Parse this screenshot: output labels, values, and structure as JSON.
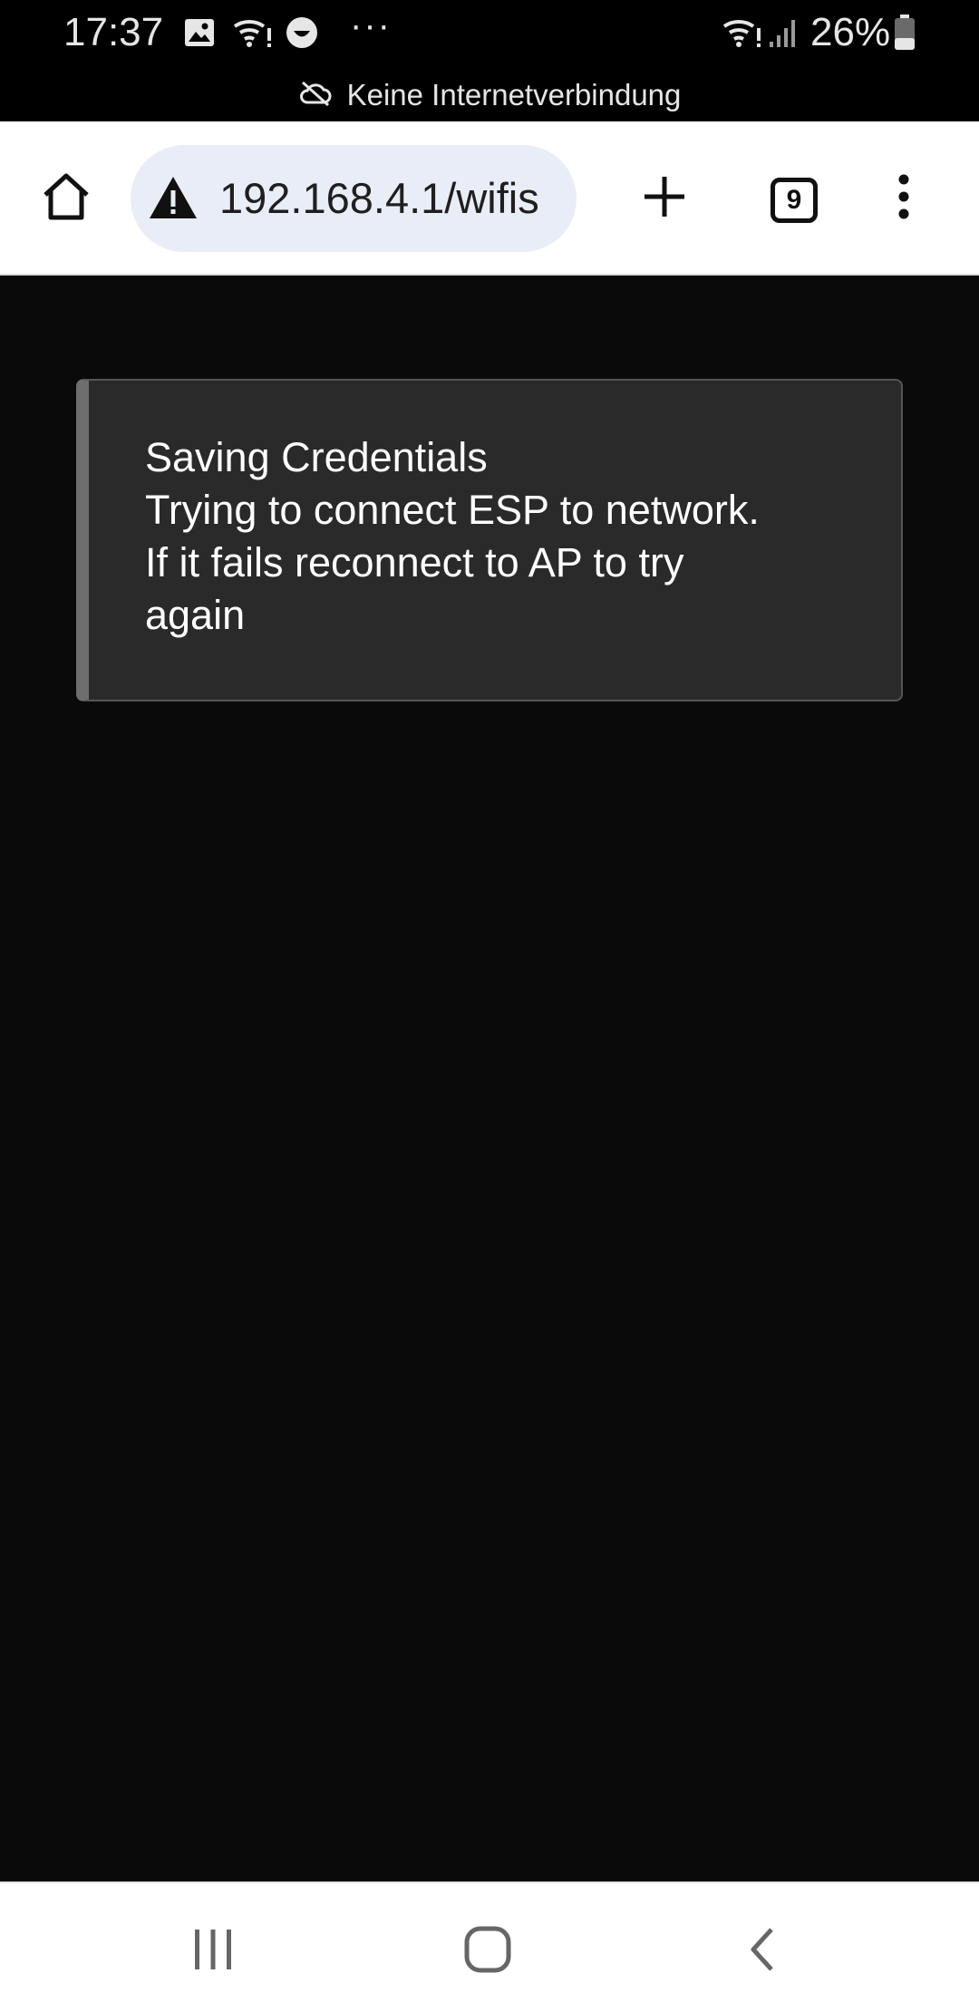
{
  "status_bar": {
    "time": "17:37",
    "icons": [
      "gallery-icon",
      "wifi-alert-icon",
      "smiley-icon",
      "more-dots-icon",
      "wifi-alert-icon",
      "signal-bars-icon",
      "battery-icon"
    ],
    "more": "···",
    "battery_percent": "26%",
    "network_status": "Keine Internetverbindung",
    "network_status_icon": "cloud-off-icon"
  },
  "browser": {
    "url": "192.168.4.1/wifis",
    "url_security_icon": "warning-triangle-icon",
    "home_icon": "home-icon",
    "new_tab_icon": "plus-icon",
    "tab_count": "9",
    "menu_icon": "kebab-menu-icon"
  },
  "message": {
    "lines": [
      "Saving Credentials",
      "Trying to connect ESP to network.",
      "If it fails reconnect to AP to try",
      "again"
    ]
  },
  "nav_bar": {
    "recents_icon": "recents-icon",
    "home_icon": "home-circle-icon",
    "back_icon": "back-chevron-icon"
  },
  "colors": {
    "status_bar_bg": "#000000",
    "toolbar_bg": "#ffffff",
    "url_pill_bg": "#e9edf7",
    "content_bg": "#0a0a0a",
    "message_bg": "#2a2a2a",
    "message_accent": "#6e6e6e",
    "message_text": "#ffffff"
  }
}
